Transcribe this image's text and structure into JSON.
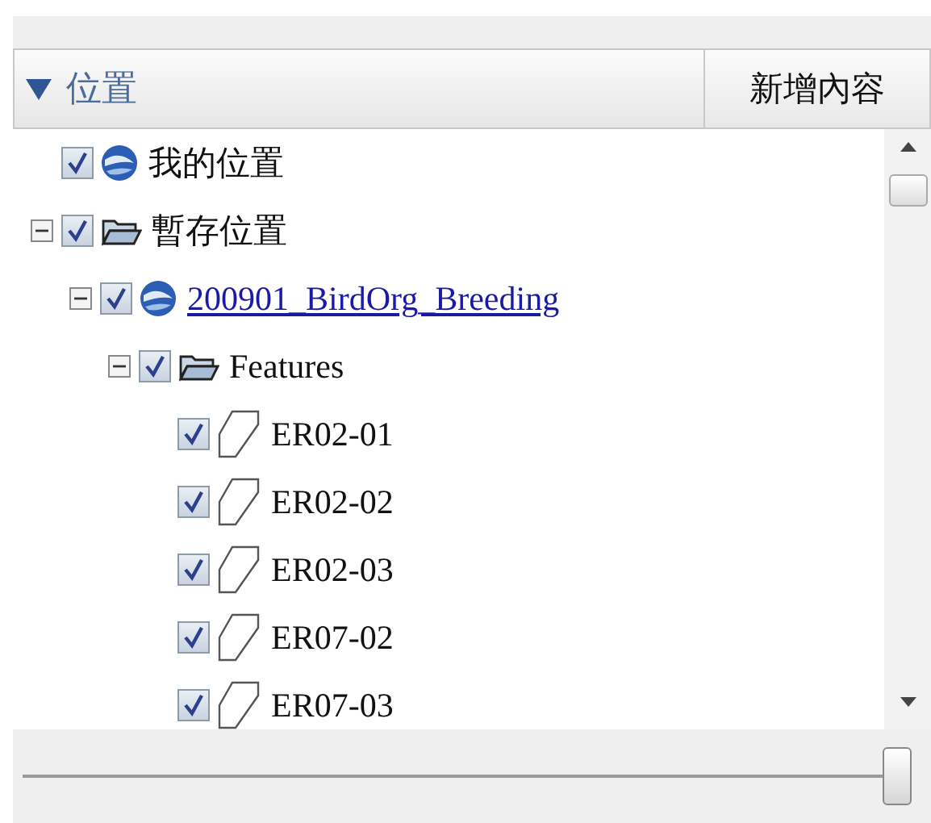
{
  "header": {
    "title": "位置",
    "expanded": true,
    "button": "新增內容"
  },
  "tree": [
    {
      "label": "我的位置",
      "kind": "earth",
      "checked": true
    },
    {
      "label": "暫存位置",
      "kind": "folder",
      "checked": true,
      "expanded": true,
      "children": [
        {
          "label": "200901_BirdOrg_Breeding",
          "kind": "earth",
          "checked": true,
          "link": true,
          "expanded": true,
          "children": [
            {
              "label": "Features",
              "kind": "folder",
              "checked": true,
              "expanded": true,
              "children": [
                {
                  "label": "ER02-01",
                  "kind": "polygon",
                  "checked": true
                },
                {
                  "label": "ER02-02",
                  "kind": "polygon",
                  "checked": true
                },
                {
                  "label": "ER02-03",
                  "kind": "polygon",
                  "checked": true
                },
                {
                  "label": "ER07-02",
                  "kind": "polygon",
                  "checked": true
                },
                {
                  "label": "ER07-03",
                  "kind": "polygon",
                  "checked": true
                }
              ]
            }
          ]
        }
      ]
    }
  ],
  "slider": {
    "level": 1
  }
}
